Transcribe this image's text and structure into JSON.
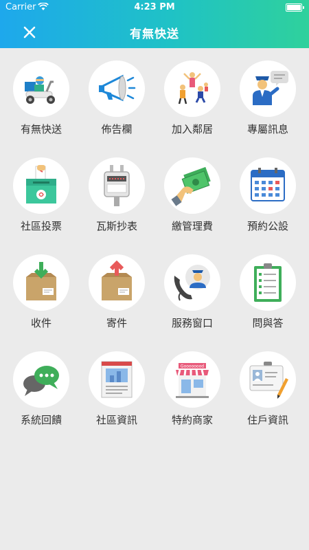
{
  "status_bar": {
    "carrier": "Carrier",
    "time": "4:23 PM"
  },
  "nav": {
    "title": "有無快送",
    "close_icon": "close-icon"
  },
  "menu": [
    {
      "label": "有無快送",
      "icon": "delivery-scooter-icon"
    },
    {
      "label": "佈告欄",
      "icon": "megaphone-icon"
    },
    {
      "label": "加入鄰居",
      "icon": "neighbors-icon"
    },
    {
      "label": "專屬訊息",
      "icon": "guard-message-icon"
    },
    {
      "label": "社區投票",
      "icon": "ballot-box-icon"
    },
    {
      "label": "瓦斯抄表",
      "icon": "gas-meter-icon"
    },
    {
      "label": "繳管理費",
      "icon": "money-hand-icon"
    },
    {
      "label": "預約公設",
      "icon": "calendar-icon"
    },
    {
      "label": "收件",
      "icon": "receive-package-icon"
    },
    {
      "label": "寄件",
      "icon": "send-package-icon"
    },
    {
      "label": "服務窗口",
      "icon": "service-phone-icon"
    },
    {
      "label": "問與答",
      "icon": "clipboard-qa-icon"
    },
    {
      "label": "系統回饋",
      "icon": "chat-bubbles-icon"
    },
    {
      "label": "社區資訊",
      "icon": "newspaper-icon"
    },
    {
      "label": "特約商家",
      "icon": "store-icon"
    },
    {
      "label": "住戶資訊",
      "icon": "id-card-icon"
    }
  ],
  "store_sign_text": "Goooooood",
  "colors": {
    "header_start": "#1ea8ec",
    "header_end": "#2fd19c",
    "background": "#ebebeb"
  }
}
